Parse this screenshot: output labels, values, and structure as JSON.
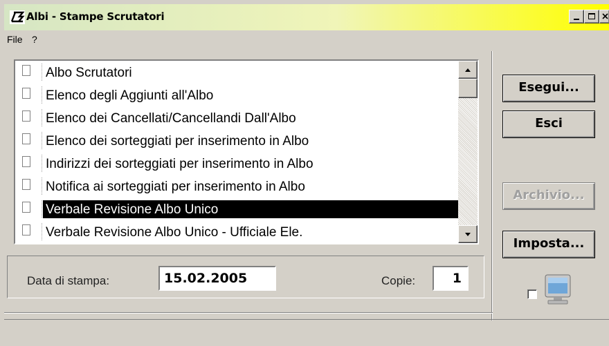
{
  "window": {
    "title": "Albi - Stampe Scrutatori",
    "title_gradient": [
      "#d6e6c4",
      "#ffff00"
    ]
  },
  "menu": [
    "File",
    "?"
  ],
  "list": {
    "items": [
      {
        "label": "Albo Scrutatori",
        "checked": false,
        "selected": false
      },
      {
        "label": "Elenco degli Aggiunti all'Albo",
        "checked": false,
        "selected": false
      },
      {
        "label": "Elenco dei Cancellati/Cancellandi Dall'Albo",
        "checked": false,
        "selected": false
      },
      {
        "label": "Elenco dei sorteggiati per inserimento in Albo",
        "checked": false,
        "selected": false
      },
      {
        "label": "Indirizzi dei sorteggiati per inserimento in Albo",
        "checked": false,
        "selected": false
      },
      {
        "label": "Notifica ai sorteggiati per inserimento in Albo",
        "checked": false,
        "selected": false
      },
      {
        "label": "Verbale Revisione Albo Unico",
        "checked": false,
        "selected": true
      },
      {
        "label": "Verbale Revisione Albo Unico - Ufficiale Ele.",
        "checked": false,
        "selected": false
      }
    ]
  },
  "form": {
    "date_label": "Data di stampa:",
    "date_value": "15.02.2005",
    "copies_label": "Copie:",
    "copies_value": "1"
  },
  "buttons": {
    "execute": "Esegui...",
    "exit": "Esci",
    "archive": "Archivio...",
    "settings": "Imposta..."
  },
  "icons": {
    "app": "app-s-icon",
    "monitor": "monitor-icon"
  }
}
